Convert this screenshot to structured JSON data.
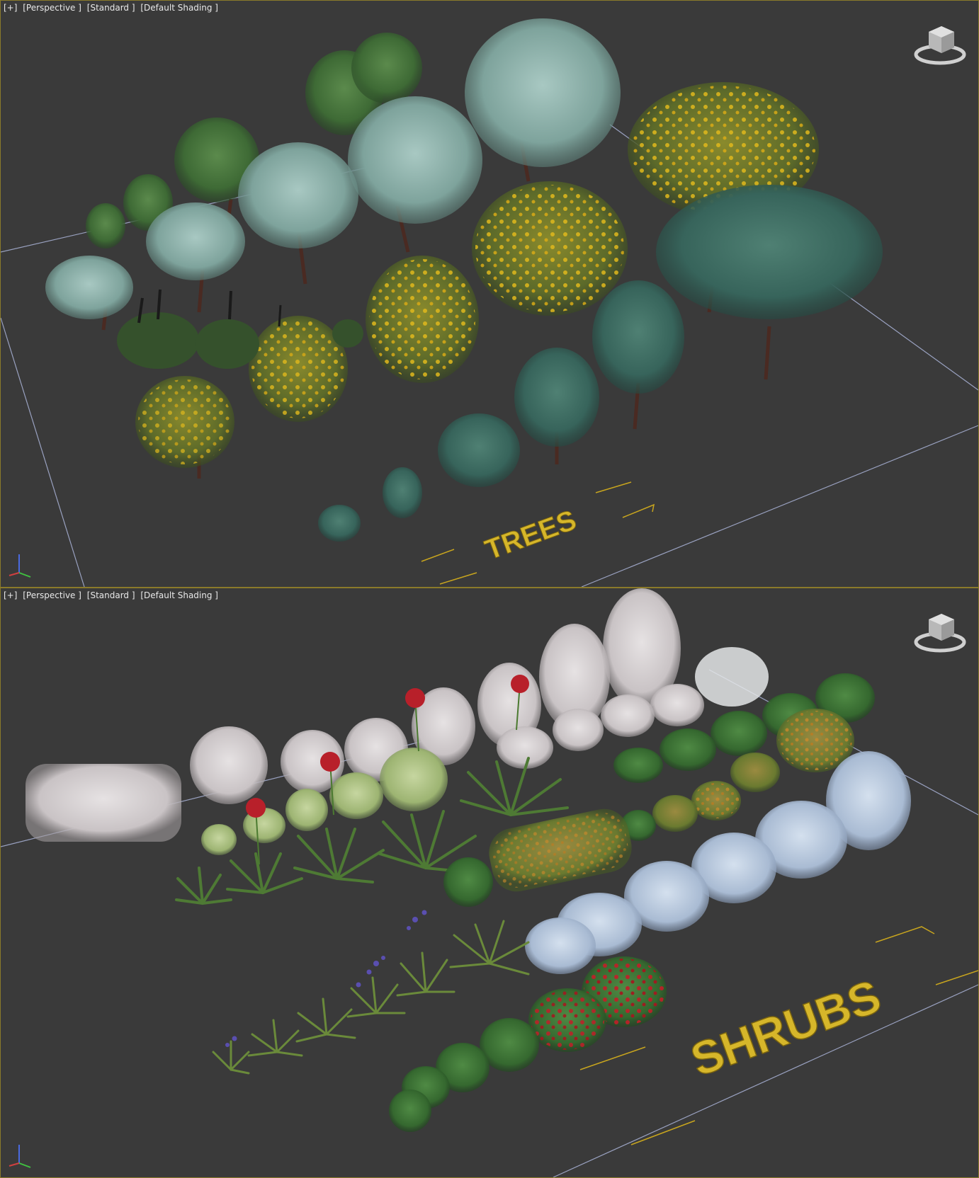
{
  "viewports": [
    {
      "id": "top",
      "label": {
        "plus": "[+]",
        "view": "[Perspective ]",
        "preset": "[Standard ]",
        "shading": "[Default Shading ]"
      },
      "scene_text": "TREES",
      "viewcube_icon": "viewcube-icon",
      "axis_icon": "world-axis-tripod-icon"
    },
    {
      "id": "bottom",
      "label": {
        "plus": "[+]",
        "view": "[Perspective ]",
        "preset": "[Standard ]",
        "shading": "[Default Shading ]"
      },
      "scene_text": "SHRUBS",
      "viewcube_icon": "viewcube-icon",
      "axis_icon": "world-axis-tripod-icon"
    }
  ],
  "colors": {
    "viewport_bg": "#3a3a3a",
    "active_border": "#8a7a2a",
    "grid_line": "#aab4d8",
    "text_3d": "#d6b62a",
    "foliage_green": "#3f6a3a",
    "foliage_teal": "#8fb3ad",
    "flower_yellow": "#d9b21c",
    "foliage_white": "#d9d4d6",
    "foliage_blue": "#b7c6dc",
    "flower_red": "#b8202a"
  }
}
